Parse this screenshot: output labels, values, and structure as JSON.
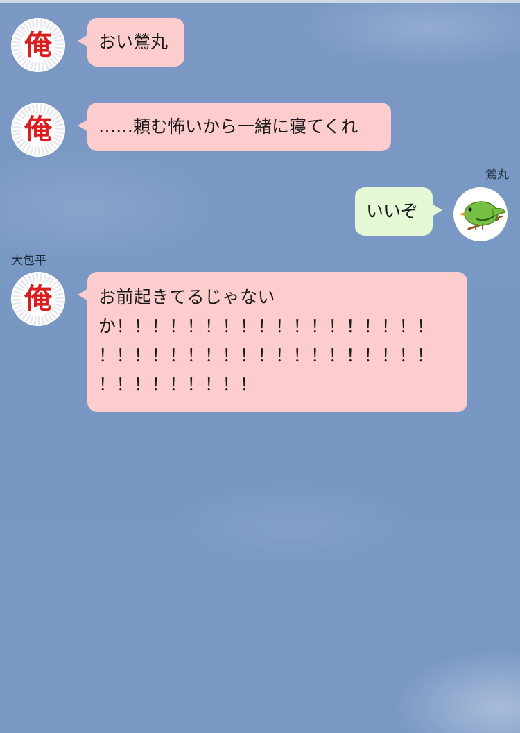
{
  "messages": [
    {
      "sender": "",
      "avatar_text": "俺",
      "text": "おい鶯丸"
    },
    {
      "sender": "",
      "avatar_text": "俺",
      "text": "……頼む怖いから一緒に寝てくれ"
    },
    {
      "sender": "鶯丸",
      "avatar_icon": "green-bird-icon",
      "text": "いいぞ"
    },
    {
      "sender": "大包平",
      "avatar_text": "俺",
      "line1": "お前起きてるじゃない",
      "line2": "か！！！！！！！！！！！！！！！！！！",
      "line3": "！！！！！！！！！！！！！！！！！！！",
      "line4": "！！！！！！！！！"
    }
  ],
  "colors": {
    "background": "#7b98c4",
    "bubble_incoming": "#fdcdcd",
    "bubble_outgoing": "#e5f9d6",
    "avatar_kanji": "#d81e1e",
    "bird_body": "#76c043"
  }
}
